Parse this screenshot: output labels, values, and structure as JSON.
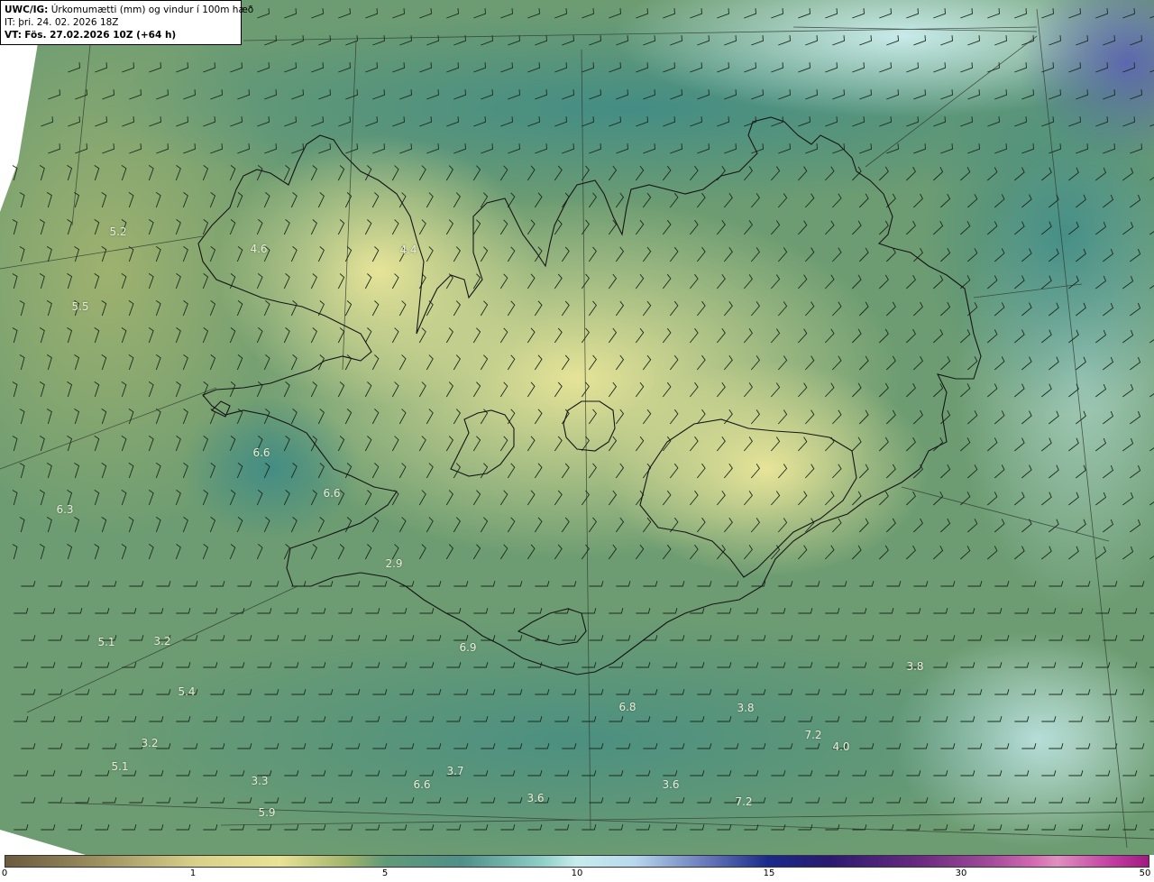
{
  "header": {
    "title_prefix": "UWC/IG:",
    "title_text": "Úrkomumætti (mm) og vindur í 100m hæð",
    "it_line": "IT: þri. 24. 02. 2026 18Z",
    "vt_prefix": "VT:",
    "vt_text": "Fös. 27.02.2026 10Z (+64 h)"
  },
  "colors": {
    "field_base": "#5f9a78",
    "field_yellow": "#e9e394",
    "field_olive": "#8fab6a",
    "field_teal": "#4f9089",
    "field_cyan": "#c8ecee",
    "field_blue": "#5e6fb5",
    "coastline": "#1a1a1a",
    "grid": "#3a3a3a"
  },
  "value_labels": [
    {
      "text": "5.2"
    },
    {
      "text": "5.5"
    },
    {
      "text": "4.6"
    },
    {
      "text": "4.4"
    },
    {
      "text": "6.6"
    },
    {
      "text": "6.6"
    },
    {
      "text": "6.3"
    },
    {
      "text": "2.9"
    },
    {
      "text": "5.1"
    },
    {
      "text": "3.2"
    },
    {
      "text": "5.4"
    },
    {
      "text": "3.2"
    },
    {
      "text": "5.1"
    },
    {
      "text": "3.3"
    },
    {
      "text": "5.9"
    },
    {
      "text": "6.6"
    },
    {
      "text": "3.7"
    },
    {
      "text": "3.6"
    },
    {
      "text": "6.9"
    },
    {
      "text": "6.8"
    },
    {
      "text": "3.6"
    },
    {
      "text": "3.8"
    },
    {
      "text": "7.2"
    },
    {
      "text": "7.2"
    },
    {
      "text": "4.0"
    },
    {
      "text": "3.8"
    }
  ],
  "colorbar": {
    "ticks": [
      "0",
      "1",
      "5",
      "10",
      "15",
      "30",
      "50"
    ]
  }
}
